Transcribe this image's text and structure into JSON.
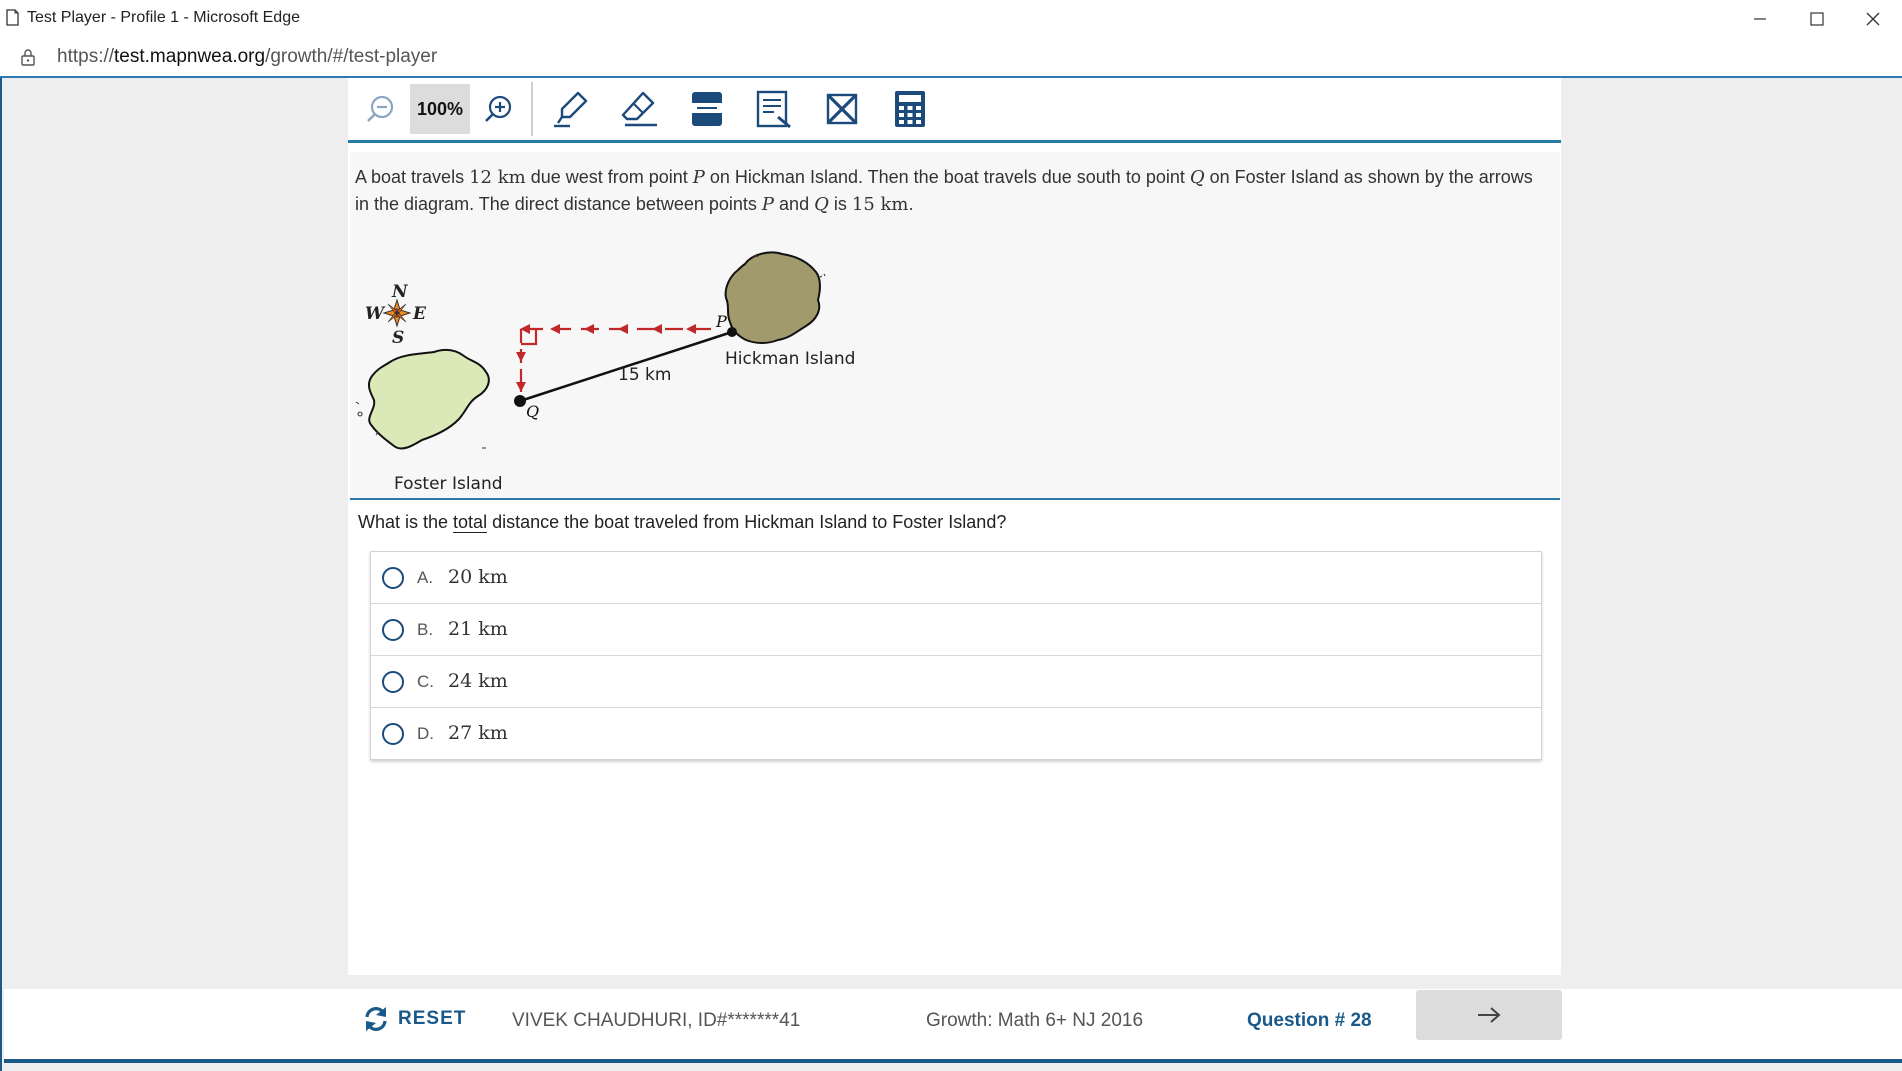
{
  "window": {
    "title": "Test Player - Profile 1 - Microsoft Edge"
  },
  "address": {
    "url_prefix": "https://",
    "url_domain": "test.mapnwea.org",
    "url_path": "/growth/#/test-player"
  },
  "toolbar": {
    "zoom_level": "100%",
    "tools": [
      "zoom-out",
      "zoom-in",
      "highlighter",
      "eraser",
      "line-reader",
      "notepad",
      "answer-eliminator",
      "calculator"
    ]
  },
  "question": {
    "stem_parts": {
      "a": "A boat travels ",
      "b": "12 km",
      "c": " due west from point ",
      "d": "P",
      "e": " on Hickman Island. Then the boat travels due south to point ",
      "f": "Q",
      "g": " on Foster Island as shown by the arrows in the diagram. The direct distance between points ",
      "h": "P",
      "i": " and ",
      "j": "Q",
      "k": " is ",
      "l": "15 km",
      "m": "."
    },
    "prompt_before": "What is the ",
    "prompt_underlined": "total",
    "prompt_after": " distance the boat traveled from Hickman Island to Foster Island?",
    "choices": [
      {
        "letter": "A.",
        "text": "20 km"
      },
      {
        "letter": "B.",
        "text": "21 km"
      },
      {
        "letter": "C.",
        "text": "24 km"
      },
      {
        "letter": "D.",
        "text": "27 km"
      }
    ]
  },
  "diagram": {
    "compass": {
      "n": "N",
      "s": "S",
      "e": "E",
      "w": "W"
    },
    "distance_label": "15 km",
    "point_p": "P",
    "point_q": "Q",
    "hickman_label": "Hickman Island",
    "foster_label": "Foster Island",
    "colors": {
      "hickman": "#a09a6c",
      "foster": "#dbe8b8",
      "arrow": "#c0282a"
    }
  },
  "footer": {
    "reset_label": "RESET",
    "student": "VIVEK CHAUDHURI, ID#*******41",
    "test_name": "Growth: Math 6+ NJ 2016",
    "question_number": "Question # 28"
  }
}
